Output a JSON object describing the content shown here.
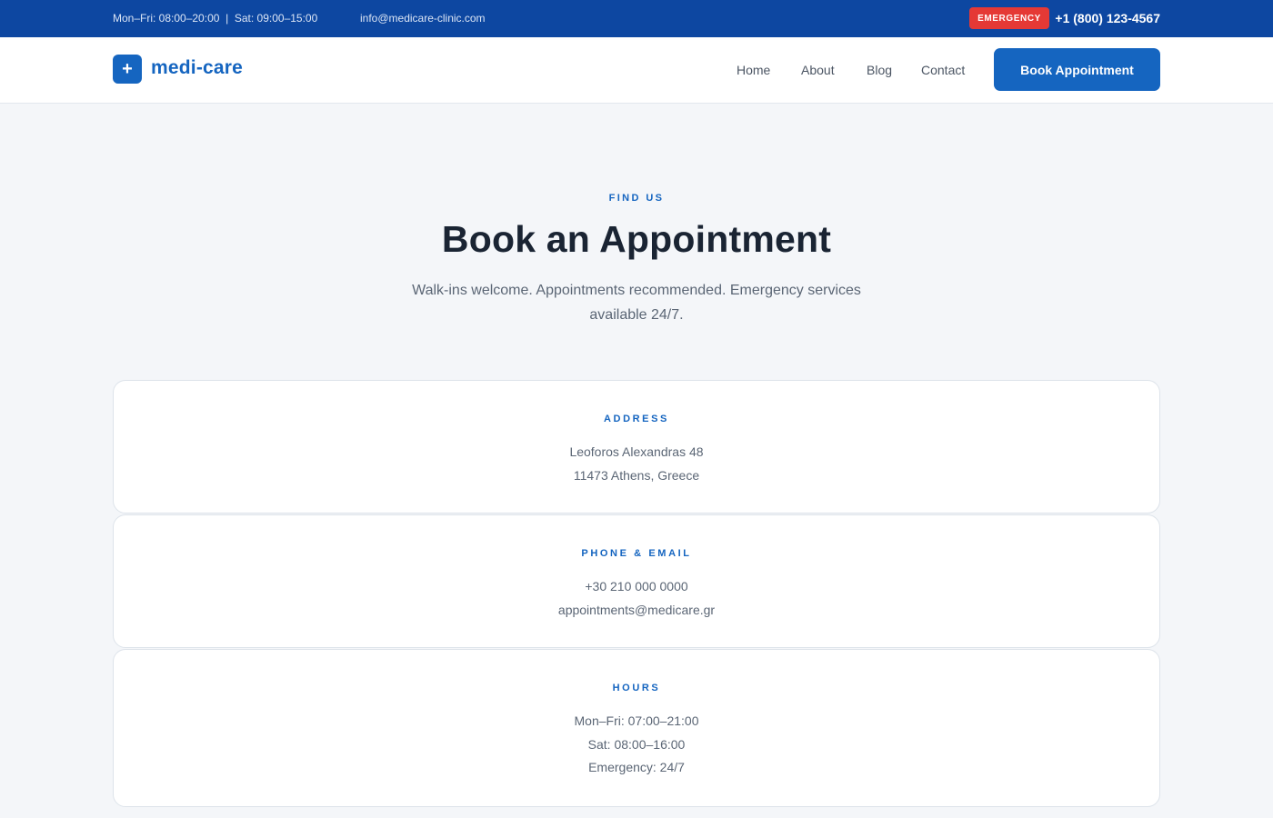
{
  "topbar": {
    "hours": "Mon–Fri: 08:00–20:00  |  Sat: 09:00–15:00",
    "email": "info@medicare-clinic.com",
    "emergency_label": "EMERGENCY",
    "phone": "+1 (800) 123-4567",
    "colors": {
      "background": "#0d47a1",
      "emergency": "#e53935"
    }
  },
  "navbar": {
    "logo_icon": "plus-icon",
    "logo_symbol": "+",
    "logo_text": "medi-care",
    "links": [
      {
        "label": "Home"
      },
      {
        "label": "About"
      },
      {
        "label": "Blog"
      },
      {
        "label": "Contact"
      }
    ],
    "cta_label": "Book Appointment",
    "colors": {
      "accent": "#1565c0"
    }
  },
  "hero": {
    "eyebrow": "FIND US",
    "title": "Book an Appointment",
    "subtitle": "Walk-ins welcome. Appointments recommended. Emergency services available 24/7."
  },
  "cards": [
    {
      "title": "ADDRESS",
      "lines": [
        "Leoforos Alexandras 48",
        "11473 Athens, Greece"
      ]
    },
    {
      "title": "PHONE & EMAIL",
      "lines": [
        "+30 210 000 0000",
        "appointments@medicare.gr"
      ]
    },
    {
      "title": "HOURS",
      "lines": [
        "Mon–Fri: 07:00–21:00",
        "Sat: 08:00–16:00",
        "Emergency: 24/7"
      ]
    }
  ]
}
